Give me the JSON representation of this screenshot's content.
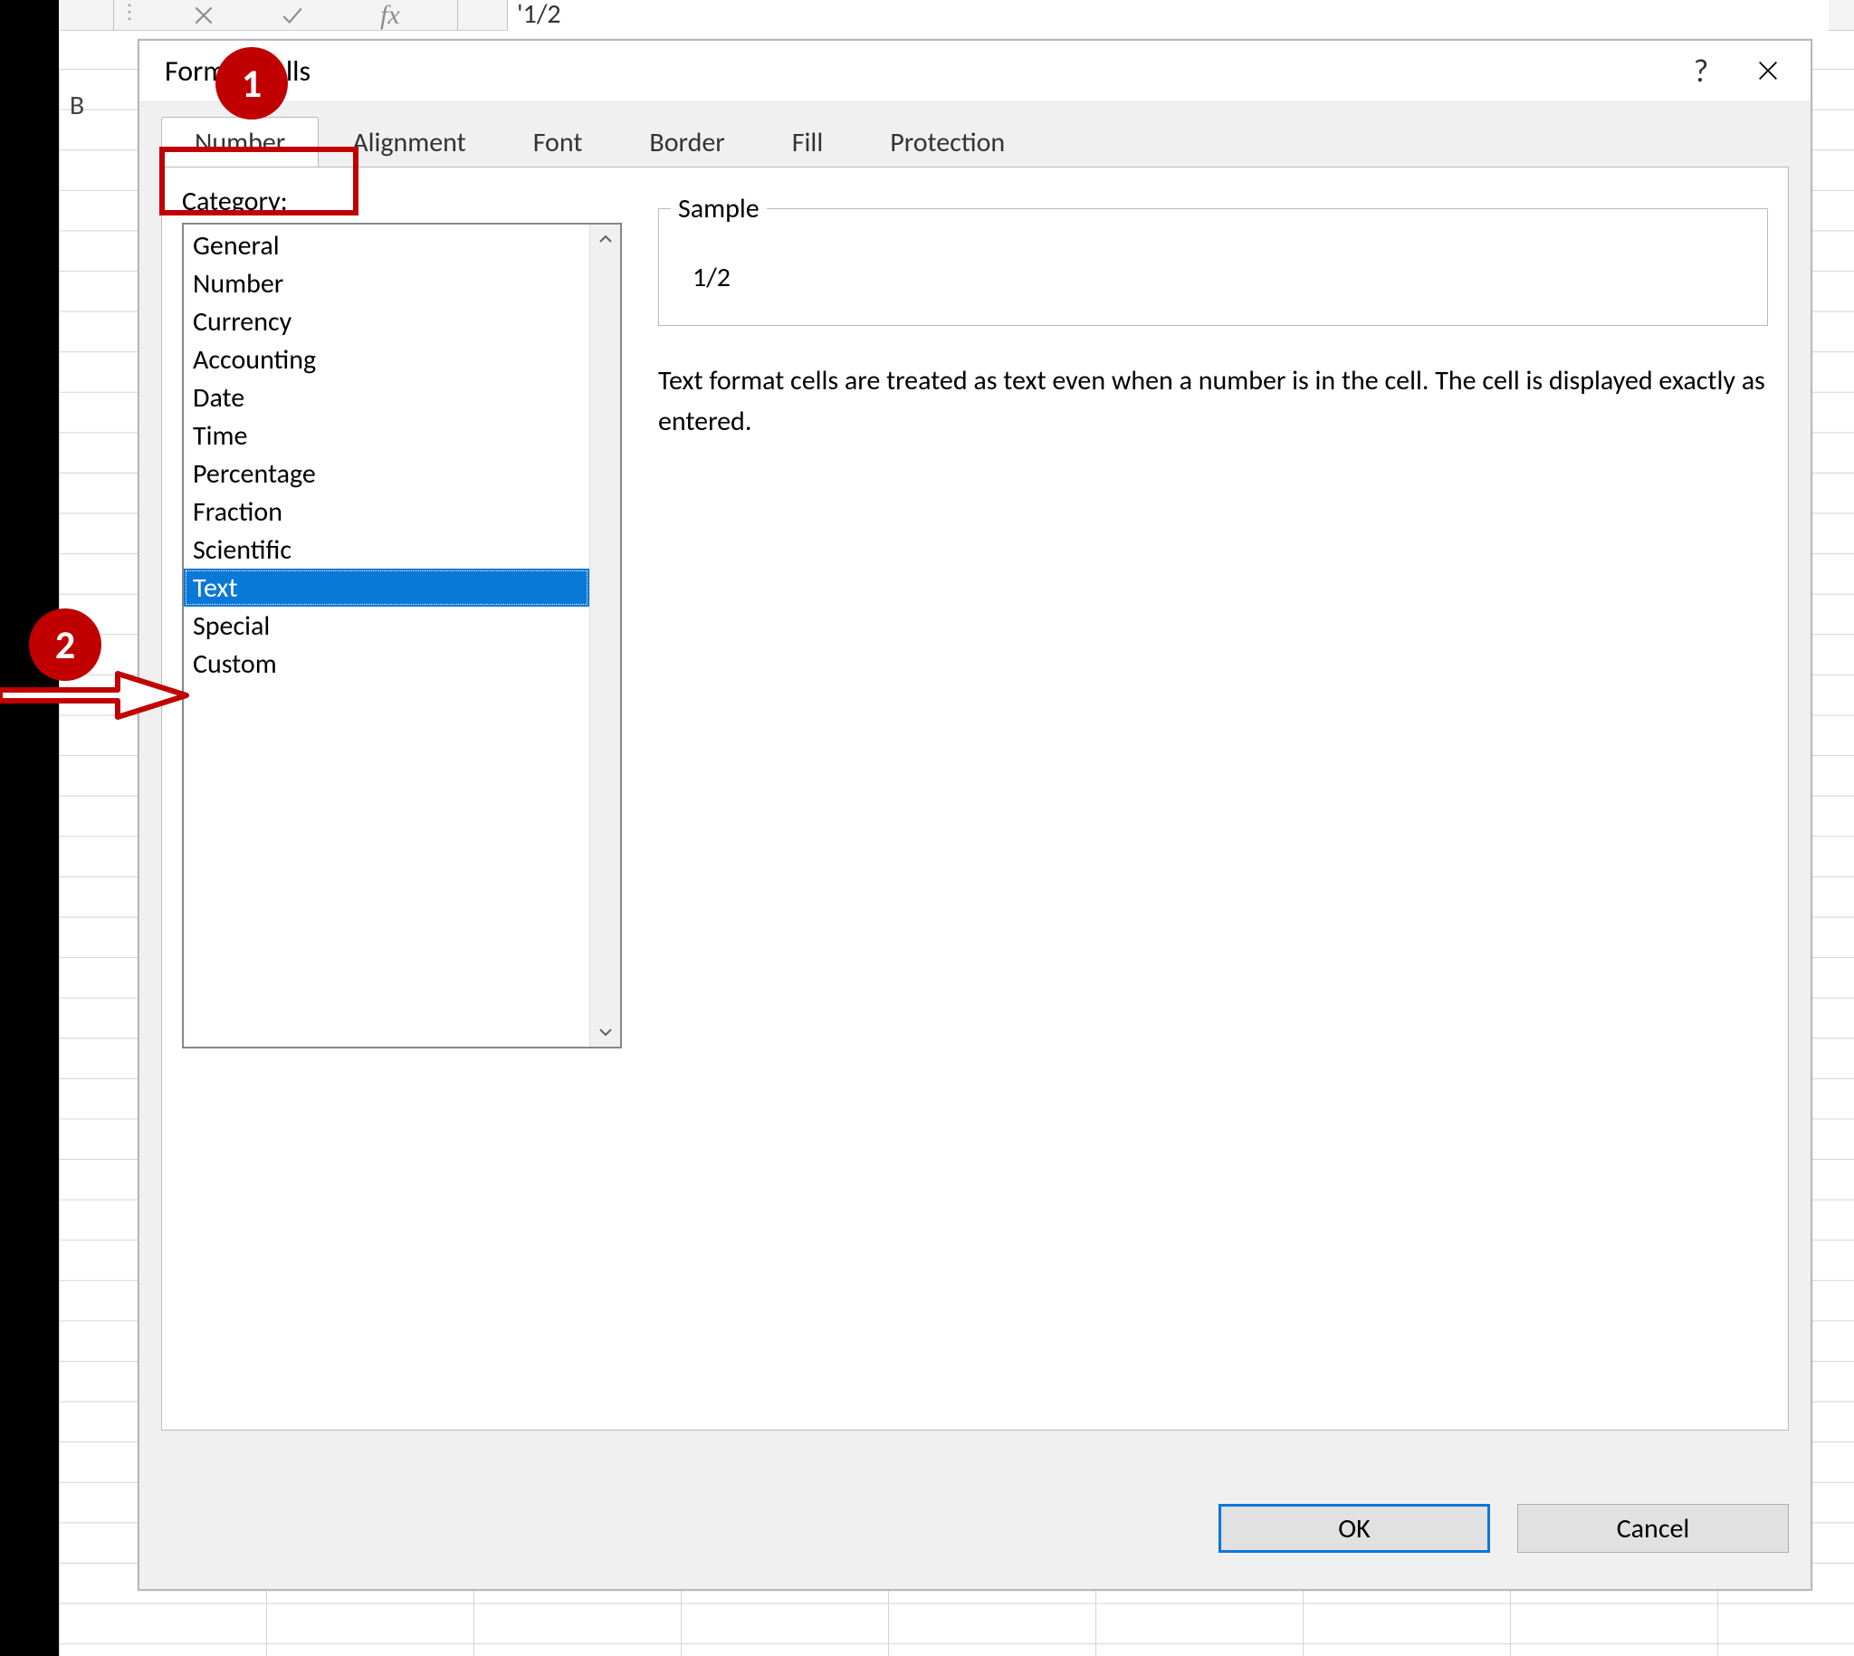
{
  "formula_bar": {
    "fx_label": "fx",
    "value": "'1/2",
    "visible_column_label": "B"
  },
  "dialog": {
    "title": "Format Cells",
    "help_label": "?",
    "tabs": [
      "Number",
      "Alignment",
      "Font",
      "Border",
      "Fill",
      "Protection"
    ],
    "active_tab": "Number",
    "category_label_prefix": "C",
    "category_label_rest": "ategory:",
    "categories": [
      "General",
      "Number",
      "Currency",
      "Accounting",
      "Date",
      "Time",
      "Percentage",
      "Fraction",
      "Scientific",
      "Text",
      "Special",
      "Custom"
    ],
    "selected_category": "Text",
    "sample": {
      "legend": "Sample",
      "value": "1/2"
    },
    "description": "Text format cells are treated as text even when a number is in the cell. The cell is displayed exactly as entered.",
    "ok_label": "OK",
    "cancel_label": "Cancel"
  },
  "annotations": {
    "callout1": "1",
    "callout2": "2"
  }
}
